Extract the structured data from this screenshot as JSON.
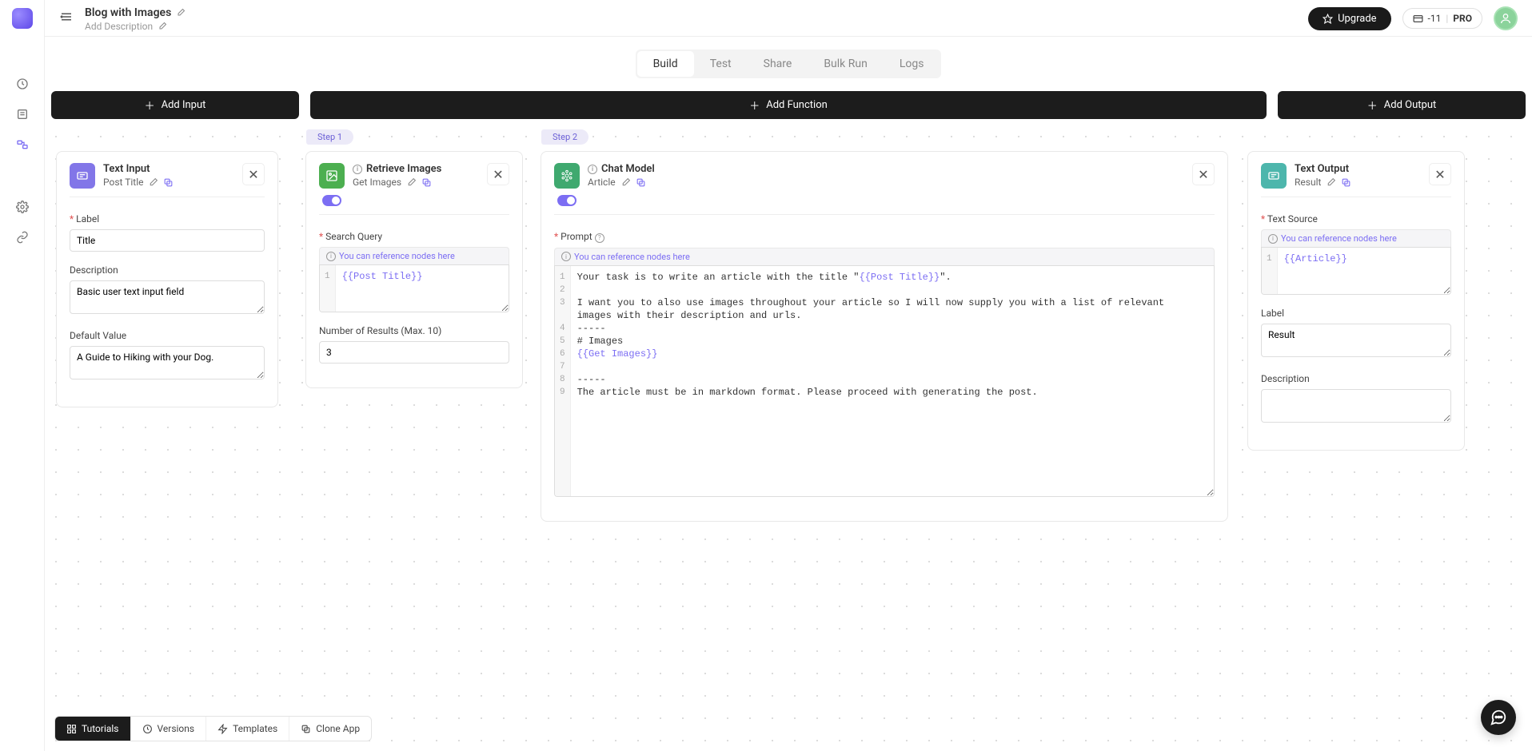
{
  "header": {
    "title": "Blog with Images",
    "add_description": "Add Description",
    "upgrade": "Upgrade",
    "credits": "-11",
    "plan": "PRO"
  },
  "tabs": [
    "Build",
    "Test",
    "Share",
    "Bulk Run",
    "Logs"
  ],
  "actions": {
    "add_input": "Add Input",
    "add_function": "Add Function",
    "add_output": "Add Output"
  },
  "hints": {
    "reference": "You can reference nodes here"
  },
  "steps": {
    "step1": "Step 1",
    "step2": "Step 2"
  },
  "input_card": {
    "type": "Text Input",
    "name": "Post Title",
    "label_label": "Label",
    "label_value": "Title",
    "desc_label": "Description",
    "desc_value": "Basic user text input field",
    "default_label": "Default Value",
    "default_value": "A Guide to Hiking with your Dog."
  },
  "retrieve_card": {
    "type": "Retrieve Images",
    "name": "Get Images",
    "query_label": "Search Query",
    "query_var": "{{Post Title}}",
    "results_label": "Number of Results (Max. 10)",
    "results_value": "3"
  },
  "chat_card": {
    "type": "Chat Model",
    "name": "Article",
    "prompt_label": "Prompt",
    "lines": {
      "l1a": "Your task is to write an article with the title \"",
      "l1b": "{{Post Title}}",
      "l1c": "\".",
      "l3": "I want you to also use images throughout your article so I will now supply you with a list of relevant images with their description and urls.",
      "l4": "-----",
      "l5": "# Images",
      "l6": "{{Get Images}}",
      "l8": "-----",
      "l9": "The article must be in markdown format. Please proceed with generating the post."
    }
  },
  "output_card": {
    "type": "Text Output",
    "name": "Result",
    "source_label": "Text Source",
    "source_var": "{{Article}}",
    "label_label": "Label",
    "label_value": "Result",
    "desc_label": "Description"
  },
  "bottom": {
    "tutorials": "Tutorials",
    "versions": "Versions",
    "templates": "Templates",
    "clone": "Clone App"
  }
}
